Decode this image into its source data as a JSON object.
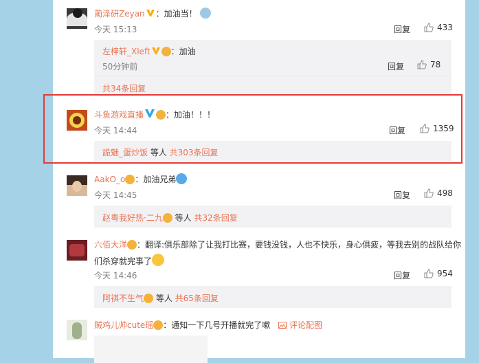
{
  "comments": [
    {
      "user": "蔺泽研Zeyan",
      "text": "：加油当！",
      "time": "今天 15:13",
      "reply": "回复",
      "likes": "433"
    },
    {
      "user": "斗鱼游戏直播",
      "text": "：加油！！！",
      "time": "今天 14:44",
      "reply": "回复",
      "likes": "1359"
    },
    {
      "user": "AakO_o",
      "text": "：加油兄弟",
      "time": "今天 14:45",
      "reply": "回复",
      "likes": "498"
    },
    {
      "user": "六佰大洋",
      "text": "：翻译:俱乐部除了让我打比赛，要钱没钱，人也不快乐，身心俱疲，等我去别的战队给你",
      "text2": "们杀穿就完事了",
      "time": "今天 14:46",
      "reply": "回复",
      "likes": "954"
    },
    {
      "user": "贼鸡儿帅cute瑶",
      "text": "：通知一下几号开播就完了嗽",
      "pic": "评论配图"
    }
  ],
  "subreply1": {
    "user": "左梓轩_Xleft",
    "text": "：加油",
    "time": "50分钟前",
    "reply": "回复",
    "likes": "78",
    "more": "共34条回复"
  },
  "subreply2": {
    "user": "詭魅_蛋炒饭",
    "mid": " 等人 ",
    "more": "共303条回复"
  },
  "subreply3": {
    "user": "赵粤我好热·二九",
    "mid": " 等人 ",
    "more": "共32条回复"
  },
  "subreply4": {
    "user": "阿祺不生气",
    "mid": " 等人 ",
    "more": "共65条回复"
  },
  "colors": {
    "accent": "#eb7350",
    "highlight": "#e53935",
    "background": "#a6d2e8",
    "subbox": "#f2f2f5",
    "vip": "#ffaa00",
    "vblue": "#2ea6f0"
  }
}
